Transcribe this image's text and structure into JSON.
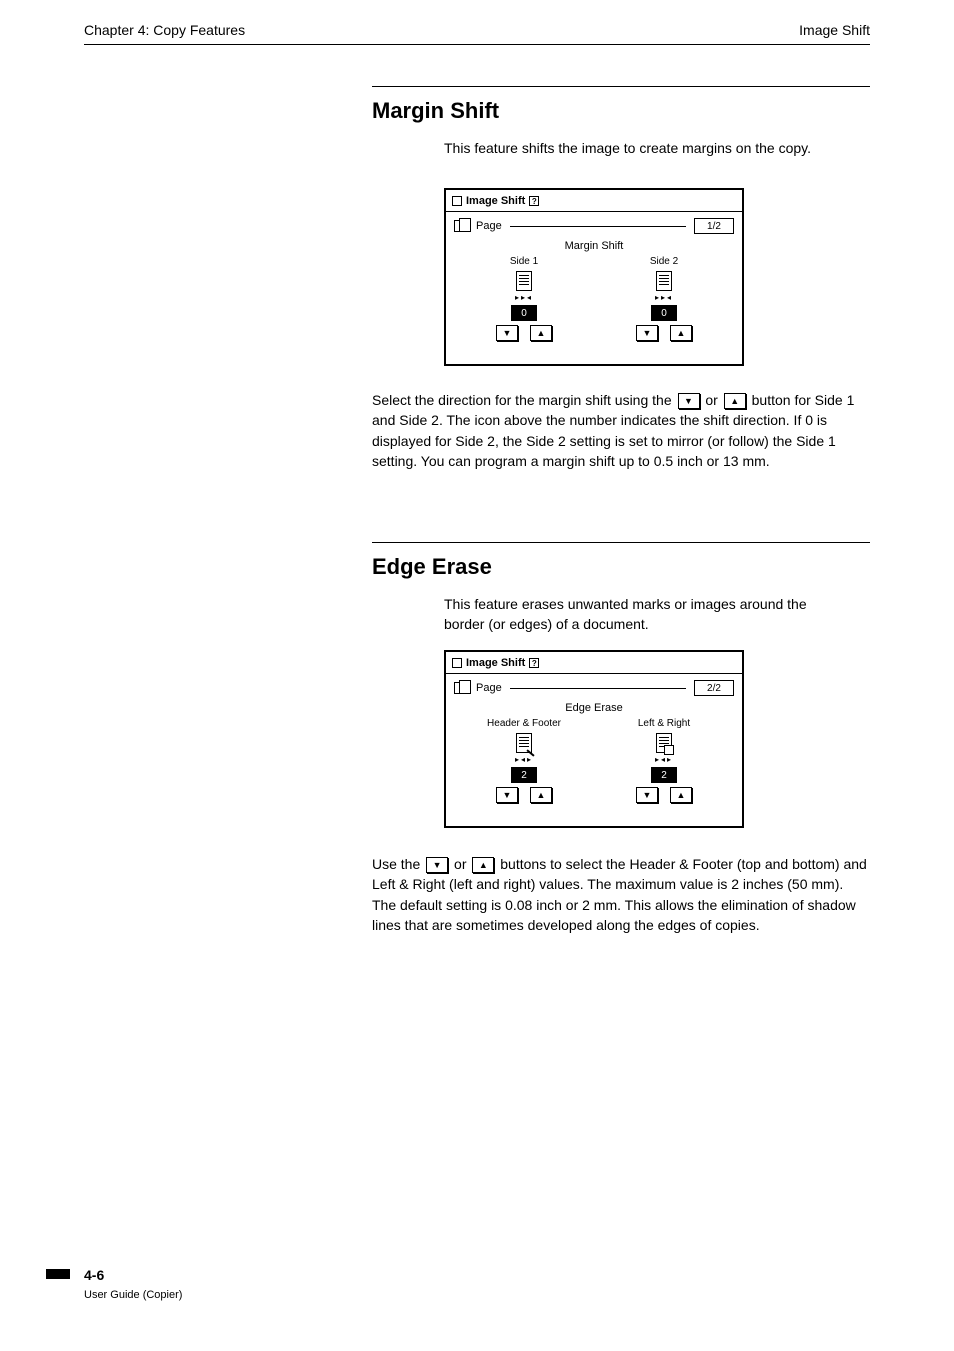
{
  "header": {
    "left": "Chapter 4: Copy Features",
    "right": "Image Shift"
  },
  "section1": {
    "title": "Margin Shift",
    "intro": "This feature shifts the image to create margins on the copy.",
    "panel": {
      "title": "Image Shift",
      "rowLabel": "Page",
      "pageValue": "1/2",
      "mainLabel": "Margin Shift",
      "columns": {
        "side1": {
          "label": "Side 1",
          "value": "0"
        },
        "side2": {
          "label": "Side 2",
          "value": "0"
        }
      }
    },
    "body": "Select the direction for the margin shift using the        or        button for Side 1 and Side 2. The icon above the number indicates the shift direction. If 0 is displayed for Side 2, the Side 2 setting is set to mirror (or follow) the Side 1 setting. You can program a margin shift up to 0.5 inch or 13 mm."
  },
  "section2": {
    "title": "Edge Erase",
    "intro": "This feature erases unwanted marks or images around the border (or edges) of a document.",
    "panel": {
      "title": "Image Shift",
      "rowLabel": "Page",
      "pageValue": "2/2",
      "mainLabel": "Edge Erase",
      "columns": {
        "header": {
          "label": "Header & Footer",
          "value": "2"
        },
        "left": {
          "label": "Left & Right",
          "value": "2"
        }
      }
    },
    "body": "Use the        or        buttons to select the Header & Footer (top and bottom) and Left & Right (left and right) values. The maximum value is 2 inches (50 mm). The default setting is 0.08 inch or 2 mm. This allows the elimination of shadow lines that are sometimes developed along the edges of copies."
  },
  "footer": {
    "pageNum": "4-6",
    "label": "User Guide (Copier)"
  }
}
